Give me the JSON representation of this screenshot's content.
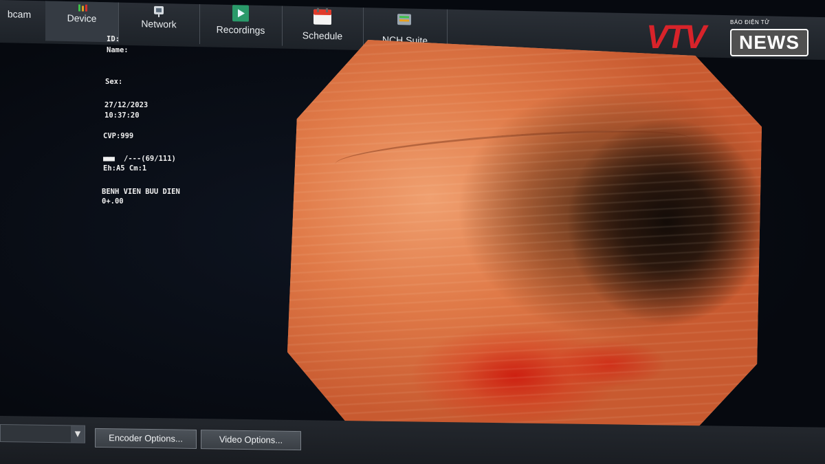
{
  "toolbar": {
    "items": [
      {
        "label": "bcam",
        "icon": "webcam-icon"
      },
      {
        "label": "Device",
        "icon": "device-icon"
      },
      {
        "label": "Network",
        "icon": "network-icon"
      },
      {
        "label": "Recordings",
        "icon": "recordings-icon"
      },
      {
        "label": "Schedule",
        "icon": "calendar-icon"
      },
      {
        "label": "NCH Suite",
        "icon": "nch-suite-icon"
      }
    ]
  },
  "logo": {
    "brand": "VTV",
    "subtitle": "BÁO ĐIỆN TỬ",
    "news": "NEWS",
    "colors": {
      "red": "#d8232a",
      "blue": "#1a3d8f"
    }
  },
  "patient": {
    "id_label": "ID:",
    "name_label": "Name:",
    "sex_label": "Sex:",
    "date": "27/12/2023",
    "time": "10:37:20",
    "cvp": "CVP:999",
    "signal": "/---(69/111)",
    "eh_cm": "Eh:A5 Cm:1",
    "hospital": "BENH VIEN BUU DIEN",
    "zero": "0+.00"
  },
  "bottom": {
    "encoder_options": "Encoder Options...",
    "video_options": "Video Options..."
  }
}
